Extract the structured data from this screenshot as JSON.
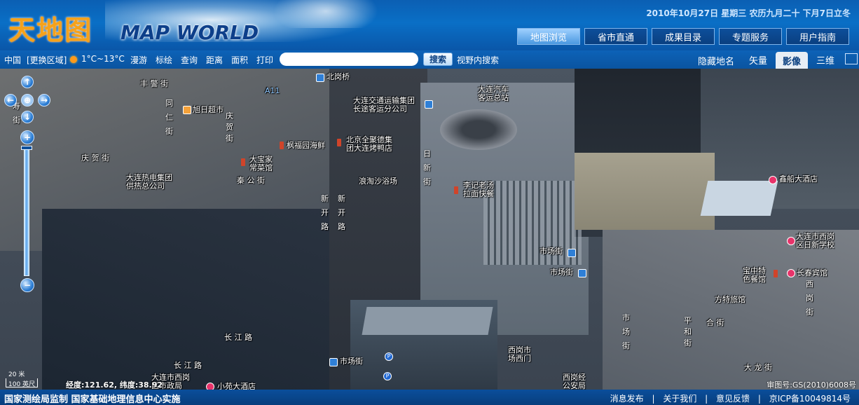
{
  "header": {
    "logo_cn": "天地图",
    "logo_en": "MAP WORLD",
    "date_line": "2010年10月27日 星期三 农历九月二十 下月7日立冬",
    "nav": [
      {
        "label": "地图浏览",
        "active": true
      },
      {
        "label": "省市直通",
        "active": false
      },
      {
        "label": "成果目录",
        "active": false
      },
      {
        "label": "专题服务",
        "active": false
      },
      {
        "label": "用户指南",
        "active": false
      }
    ]
  },
  "toolbar": {
    "region": "中国",
    "change_region": "[更换区域]",
    "weather": "1°C~13°C",
    "tools": [
      "漫游",
      "标绘",
      "查询",
      "距离",
      "面积",
      "打印"
    ],
    "search_placeholder": "",
    "search_button": "搜索",
    "view_search": "视野内搜索",
    "hide_names": "隐藏地名",
    "map_types": [
      "矢量",
      "影像",
      "三维"
    ],
    "active_map_type": "影像"
  },
  "map": {
    "scale_top": "20 米",
    "scale_bottom": "100 英尺",
    "coords": "经度:121.62, 纬度:38.92",
    "copyright": "审图号:GS(2010)6008号",
    "labels": {
      "beigangqiao": "北岗桥",
      "fengjingjie": "丰 警 街",
      "xurichaoshi": "旭日超市",
      "qingheijie": "庆 贺 街",
      "fengfuyuan": "枫福园海鲜",
      "beijingquanjude": "北京全聚德集\n团大连烤鸭店",
      "dalianjiaotong": "大连交通运输集团\n长途客运分公司",
      "dalianqiche": "大连汽车\n客运总站",
      "dabaojia": "大宝家\n常菜馆",
      "daliansheji": "大连热电集团\n供热总公司",
      "qinggong": "秦 公 街",
      "langtaoshayu": "浪淘沙浴场",
      "lijilaoshou": "李记老汤\n拉面快餐",
      "shichangjie1": "市场街",
      "shichangjie2": "市场街",
      "shichangjie3": "市场街",
      "xinfuchuanjiudian": "鑫船大酒店",
      "dalianshixigang": "大连市西岗\n区日新学校",
      "baozhongte": "宝中特\n色餐馆",
      "changchunbinguan": "长春宾馆",
      "fangtelvguan": "方特旅馆",
      "changjianglu": "长 江 路",
      "changjianglu2": "长 江 路",
      "dalianshixigang2": "大连市西岗\n区市政局",
      "xigangshichang": "西岗市\n场西门",
      "xigangjing": "西岗经\n公安局",
      "xiaoyao": "小苑大酒店",
      "dalongjie": "大 龙 街",
      "pinghejie": "平 和 街",
      "hejie": "合 街",
      "a11": "A11",
      "xiyinjie": "寿\n街",
      "tongrenjie": "同\n仁\n街",
      "qinghejie_v": "庆\n贺\n街",
      "xinkailu1": "新\n开\n路",
      "xinkailu2": "新\n开\n路",
      "rixinjie": "日\n新\n街",
      "shichangjie_v": "市\n场\n街",
      "xigangjie_v": "西\n岗\n街",
      "pinghe_v": "平\n和\n街"
    }
  },
  "footer": {
    "left": "国家测绘局监制   国家基础地理信息中心实施",
    "links": [
      "消息发布",
      "关于我们",
      "意见反馈",
      "京ICP备10049814号"
    ],
    "separator": "|"
  },
  "colors": {
    "header_blue": "#0a6fc6",
    "active_nav": "#4a98e0",
    "logo_orange": "#f5a21b",
    "footer_blue": "#083e7d"
  }
}
